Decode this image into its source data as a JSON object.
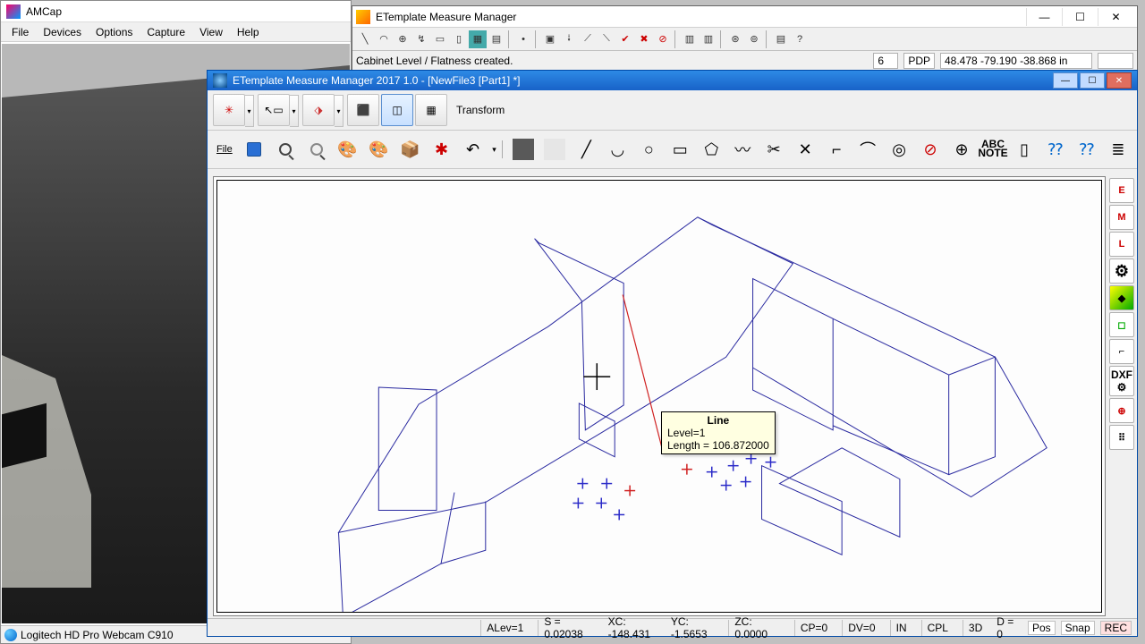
{
  "amcap": {
    "title": "AMCap",
    "menu": [
      "File",
      "Devices",
      "Options",
      "Capture",
      "View",
      "Help"
    ],
    "status_device": "Logitech HD Pro Webcam C910"
  },
  "et_top": {
    "title": "ETemplate Measure Manager",
    "status_msg": "Cabinet Level / Flatness created.",
    "field_num": "6",
    "mode": "PDP",
    "coords": "48.478  -79.190  -38.868 in"
  },
  "et_main": {
    "title": "ETemplate Measure Manager 2017 1.0  - [NewFile3 [Part1] *]",
    "transform_label": "Transform",
    "file_label": "File",
    "abc_note_line1": "ABC",
    "abc_note_line2": "NOTE",
    "dxf_label": "DXF",
    "tooltip": {
      "title": "Line",
      "level": "Level=1",
      "length": "Length = 106.872000"
    },
    "sidebar": [
      "E",
      "M",
      "L"
    ],
    "status": {
      "alev": "ALev=1",
      "s": "S = 0.02038",
      "xc": "XC: -148.431",
      "yc": "YC: -1.5653",
      "zc": "ZC: 0.0000",
      "cp": "CP=0",
      "dv": "DV=0",
      "in": "IN",
      "cpl": "CPL",
      "threeD": "3D",
      "d": "D = 0",
      "pos": "Pos",
      "snap": "Snap",
      "rec": "REC"
    }
  },
  "chart_data": {
    "type": "diagram",
    "description": "3D wireframe room / cabinet layout isometric view",
    "selected_line": {
      "length": 106.872,
      "level": 1
    },
    "markers": {
      "blue_cross_count": 11,
      "red_cross_count": 2
    }
  }
}
